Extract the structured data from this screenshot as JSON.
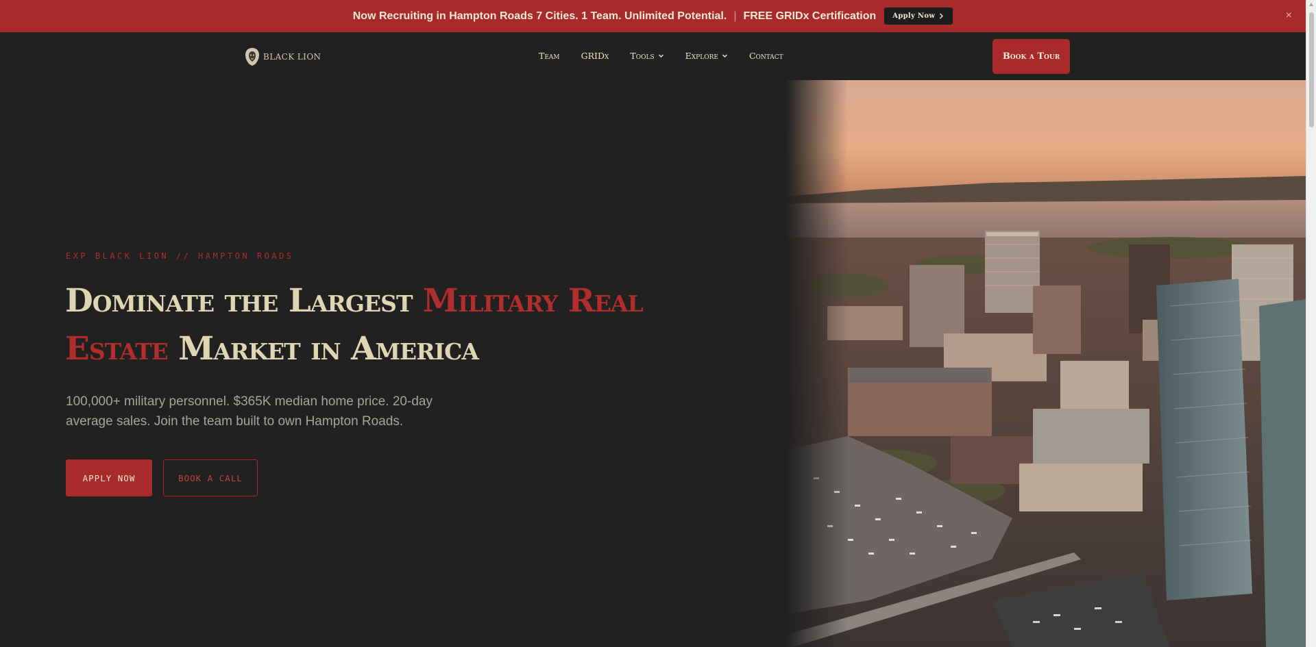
{
  "announcement": {
    "message": "Now Recruiting in Hampton Roads 7 Cities. 1 Team. Unlimited Potential.",
    "separator": "|",
    "promo": "FREE GRIDx Certification",
    "cta_label": "Apply Now",
    "close_icon": "×"
  },
  "nav": {
    "logo_text": "BLACK LION",
    "links": [
      "Team",
      "GRIDx",
      "Tools",
      "Explore",
      "Contact"
    ],
    "cta_label": "Book a Tour"
  },
  "hero": {
    "eyebrow": "EXP BLACK LION // HAMPTON ROADS",
    "headline_start": "Dominate the Largest ",
    "headline_accent": "Military Real Estate",
    "headline_end": " Market in America",
    "subtext": "100,000+ military personnel. $365K median home price. 20-day average sales. Join the team built to own Hampton Roads.",
    "primary_button": "APPLY NOW",
    "secondary_button": "BOOK A CALL"
  },
  "colors": {
    "brand_red": "#a82a2a",
    "background": "#212121",
    "headline_cream": "#ded5b4"
  }
}
